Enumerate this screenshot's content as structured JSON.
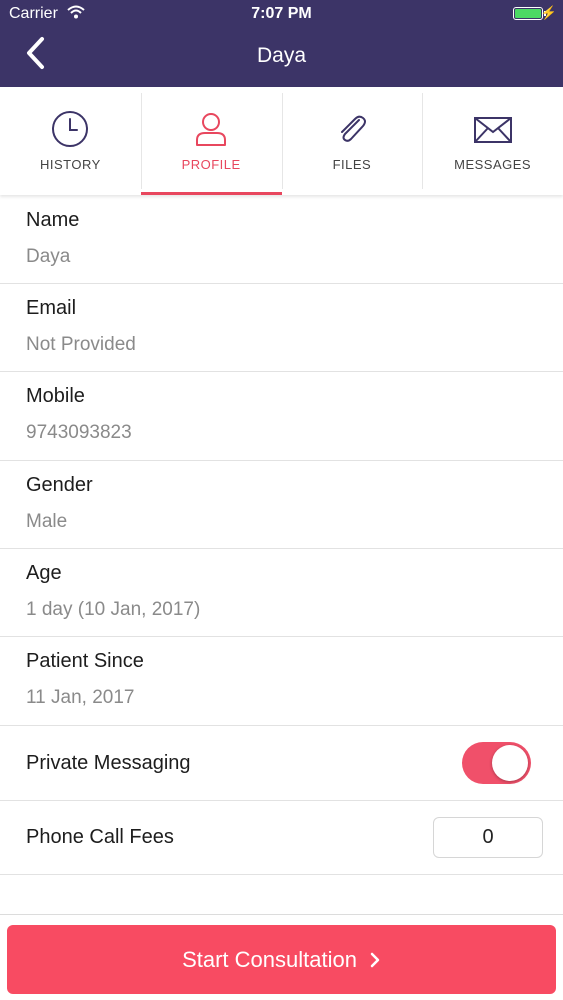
{
  "status_bar": {
    "carrier": "Carrier",
    "time": "7:07 PM",
    "battery_color": "#4cd964"
  },
  "header": {
    "title": "Daya",
    "background": "#3c3467"
  },
  "tabs": [
    {
      "label": "HISTORY",
      "icon": "clock-icon",
      "active": false
    },
    {
      "label": "PROFILE",
      "icon": "person-icon",
      "active": true
    },
    {
      "label": "FILES",
      "icon": "paperclip-icon",
      "active": false
    },
    {
      "label": "MESSAGES",
      "icon": "envelope-icon",
      "active": false
    }
  ],
  "profile": {
    "name": {
      "label": "Name",
      "value": "Daya"
    },
    "email": {
      "label": "Email",
      "value": "Not Provided"
    },
    "mobile": {
      "label": "Mobile",
      "value": "9743093823"
    },
    "gender": {
      "label": "Gender",
      "value": "Male"
    },
    "age": {
      "label": "Age",
      "value": "1 day (10 Jan, 2017)"
    },
    "patient_since": {
      "label": "Patient Since",
      "value": "11 Jan, 2017"
    }
  },
  "settings": {
    "private_messaging": {
      "label": "Private Messaging",
      "enabled": true
    },
    "phone_call_fees": {
      "label": "Phone Call Fees",
      "value": "0"
    }
  },
  "cta": {
    "label": "Start Consultation",
    "color": "#f84b62"
  },
  "accent_color": "#e8475e"
}
